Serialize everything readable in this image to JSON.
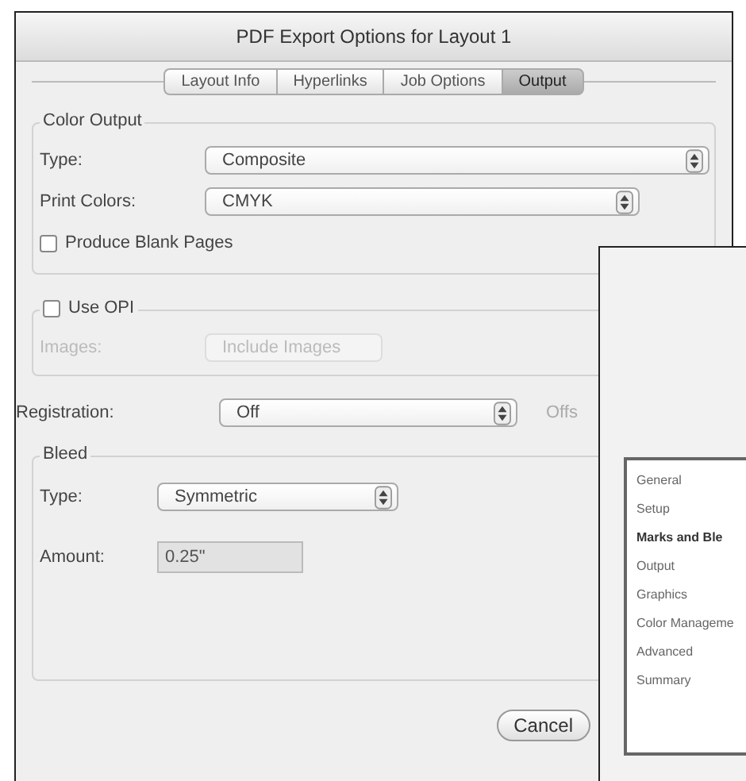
{
  "window": {
    "title": "PDF Export Options for Layout 1"
  },
  "tabs": [
    {
      "label": "Layout Info",
      "selected": false
    },
    {
      "label": "Hyperlinks",
      "selected": false
    },
    {
      "label": "Job Options",
      "selected": false
    },
    {
      "label": "Output",
      "selected": true
    }
  ],
  "color_output": {
    "title": "Color Output",
    "type": {
      "label": "Type:",
      "value": "Composite"
    },
    "print_colors": {
      "label": "Print Colors:",
      "value": "CMYK"
    },
    "produce_blank_pages": {
      "label": "Produce Blank Pages",
      "checked": false
    }
  },
  "opi": {
    "label": "Use OPI",
    "checked": false,
    "images": {
      "label": "Images:",
      "value": "Include Images",
      "disabled": true
    }
  },
  "registration": {
    "label": "Registration:",
    "value": "Off",
    "offset_label": "Offs"
  },
  "bleed": {
    "title": "Bleed",
    "type": {
      "label": "Type:",
      "value": "Symmetric"
    },
    "amount": {
      "label": "Amount:",
      "value": "0.25\""
    }
  },
  "buttons": [
    "Cancel"
  ],
  "back_window": {
    "list": [
      {
        "label": "General",
        "selected": false
      },
      {
        "label": "Setup",
        "selected": false
      },
      {
        "label": "Marks and Ble",
        "selected": true
      },
      {
        "label": "Output",
        "selected": false
      },
      {
        "label": "Graphics",
        "selected": false
      },
      {
        "label": "Color Manageme",
        "selected": false
      },
      {
        "label": "Advanced",
        "selected": false
      },
      {
        "label": "Summary",
        "selected": false
      }
    ]
  }
}
